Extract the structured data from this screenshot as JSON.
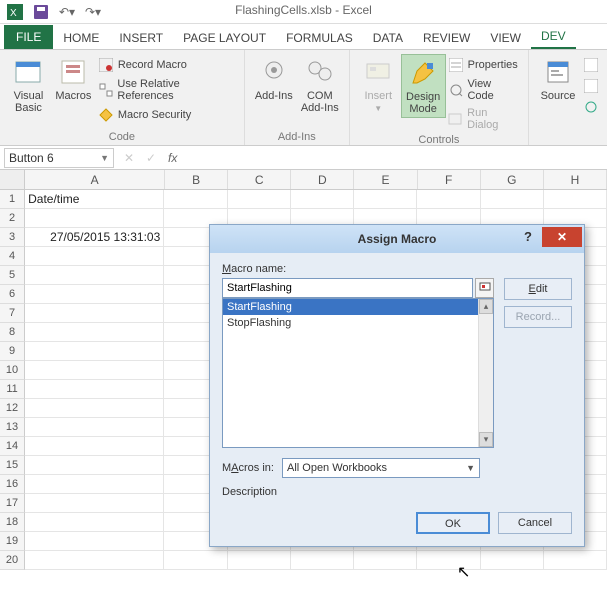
{
  "app": {
    "title": "FlashingCells.xlsb - Excel"
  },
  "qat": {
    "items": [
      "excel",
      "save",
      "undo",
      "redo"
    ]
  },
  "tabs": {
    "file": "FILE",
    "items": [
      "HOME",
      "INSERT",
      "PAGE LAYOUT",
      "FORMULAS",
      "DATA",
      "REVIEW",
      "VIEW",
      "DEV"
    ],
    "activeIndex": 7
  },
  "ribbon": {
    "code": {
      "label": "Code",
      "visualBasic": "Visual\nBasic",
      "macros": "Macros",
      "recordMacro": "Record Macro",
      "useRelative": "Use Relative References",
      "macroSecurity": "Macro Security"
    },
    "addins": {
      "label": "Add-Ins",
      "addins": "Add-Ins",
      "com": "COM\nAdd-Ins"
    },
    "controls": {
      "label": "Controls",
      "insert": "Insert",
      "designMode": "Design\nMode",
      "properties": "Properties",
      "viewCode": "View Code",
      "runDialog": "Run Dialog"
    },
    "source": {
      "source": "Source"
    }
  },
  "namebox": {
    "value": "Button 6"
  },
  "sheet": {
    "cols": [
      "A",
      "B",
      "C",
      "D",
      "E",
      "F",
      "G",
      "H"
    ],
    "data": {
      "A1": "Date/time",
      "A3": "27/05/2015 13:31:03"
    },
    "rowCount": 20
  },
  "dialog": {
    "title": "Assign Macro",
    "macroNameLabel": "Macro name:",
    "macroNameLetter": "M",
    "macroName": "StartFlashing",
    "macros": [
      "StartFlashing",
      "StopFlashing"
    ],
    "selectedIndex": 0,
    "editLabel": "Edit",
    "editLetter": "E",
    "recordLabel": "Record...",
    "recordLetter": "R",
    "macrosInLabel": "Macros in:",
    "macrosInLetter": "A",
    "macrosInValue": "All Open Workbooks",
    "descriptionLabel": "Description",
    "ok": "OK",
    "cancel": "Cancel"
  }
}
